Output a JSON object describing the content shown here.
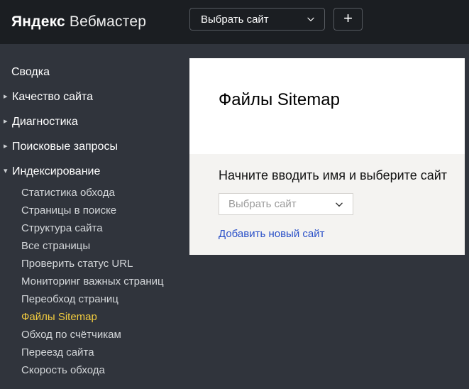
{
  "header": {
    "logo": {
      "brand": "Яндекс",
      "product": "Вебмастер"
    },
    "site_select_value": "Выбрать сайт",
    "add_site_label": "+"
  },
  "sidebar": {
    "top_items": [
      {
        "label": "Сводка",
        "expandable": false
      },
      {
        "label": "Качество сайта",
        "expandable": true,
        "expanded": false
      },
      {
        "label": "Диагностика",
        "expandable": true,
        "expanded": false
      },
      {
        "label": "Поисковые запросы",
        "expandable": true,
        "expanded": false
      },
      {
        "label": "Индексирование",
        "expandable": true,
        "expanded": true
      }
    ],
    "sub_items": [
      "Статистика обхода",
      "Страницы в поиске",
      "Структура сайта",
      "Все страницы",
      "Проверить статус URL",
      "Мониторинг важных страниц",
      "Переобход страниц",
      "Файлы Sitemap",
      "Обход по счётчикам",
      "Переезд сайта",
      "Скорость обхода"
    ],
    "active_item": "Файлы Sitemap"
  },
  "main": {
    "title": "Файлы Sitemap",
    "picker": {
      "heading": "Начните вводить имя и выберите сайт",
      "select_placeholder": "Выбрать сайт",
      "add_link": "Добавить новый сайт"
    }
  },
  "icons": {
    "expand_arrow": "▸",
    "collapse_arrow": "▾"
  },
  "colors": {
    "header_bg": "#1b1e22",
    "body_bg": "#30343c",
    "panel_gray": "#f4f3f1",
    "active_yellow": "#f2cc3f",
    "link_blue": "#2a50c8"
  }
}
